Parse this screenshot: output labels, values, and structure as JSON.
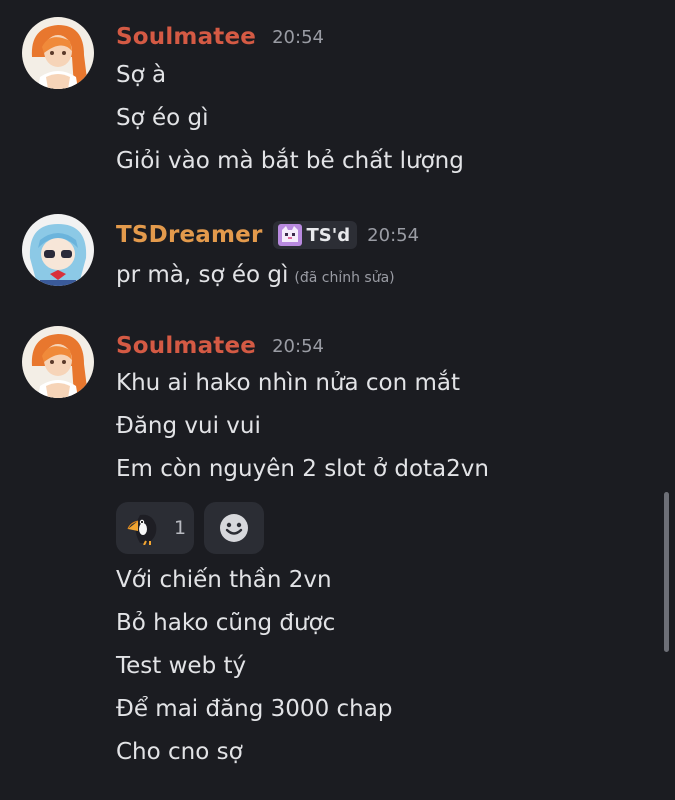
{
  "messages": [
    {
      "author": "Soulmatee",
      "author_color": "#d45a44",
      "time": "20:54",
      "lines": [
        "Sợ à",
        "Sợ éo gì",
        "Giỏi vào mà bắt bẻ chất lượng"
      ]
    },
    {
      "author": "TSDreamer",
      "author_color": "#e39a4c",
      "role_tag": "TS'd",
      "time": "20:54",
      "lines": [
        "pr mà, sợ éo gì"
      ],
      "edited_label": "(đã chỉnh sửa)"
    },
    {
      "author": "Soulmatee",
      "author_color": "#d45a44",
      "time": "20:54",
      "lines_before_reactions": [
        "Khu ai hako nhìn nửa con mắt",
        "Đăng vui vui",
        "Em còn nguyên 2 slot ở dota2vn"
      ],
      "reactions": [
        {
          "icon": "toucan-emoji-icon",
          "count": "1"
        },
        {
          "icon": "add-reaction-smiley-icon"
        }
      ],
      "lines_after_reactions": [
        "Với chiến thần 2vn",
        "Bỏ hako cũng được",
        "Test web tý",
        "Để mai đăng 3000 chap",
        "Cho cno sợ"
      ]
    }
  ]
}
